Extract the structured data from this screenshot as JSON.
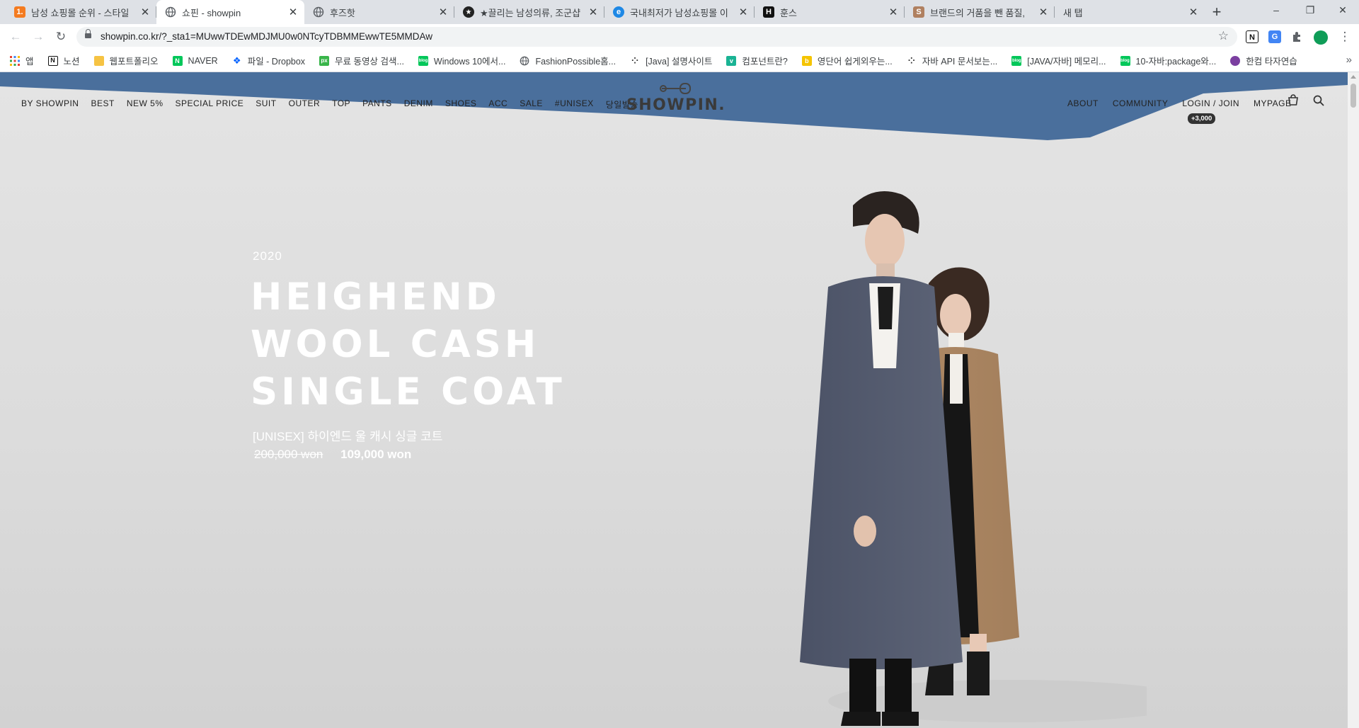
{
  "browser": {
    "tabs": [
      {
        "title": "남성 쇼핑몰 순위 - 스타일",
        "favicon": "1.",
        "favicon_color": "#f47b20",
        "active": false
      },
      {
        "title": "쇼핀 - showpin",
        "favicon": "globe-icon",
        "favicon_color": "#5f6368",
        "active": true
      },
      {
        "title": "후즈핫",
        "favicon": "globe-icon",
        "favicon_color": "#5f6368",
        "active": false
      },
      {
        "title": "★끌리는 남성의류, 조군샵",
        "favicon": "star-badge-icon",
        "favicon_color": "#222222",
        "active": false
      },
      {
        "title": "국내최저가 남성쇼핑몰 이",
        "favicon": "e",
        "favicon_color": "#1e88e5",
        "active": false
      },
      {
        "title": "훈스",
        "favicon": "H",
        "favicon_color": "#111111",
        "active": false
      },
      {
        "title": "브랜드의 거품을 뺀 품질,",
        "favicon": "S",
        "favicon_color": "#b08060",
        "active": false
      },
      {
        "title": "새 탭",
        "favicon": "",
        "favicon_color": "#dee1e6",
        "active": false
      }
    ],
    "new_tab_label": "+",
    "window_controls": {
      "minimize": "–",
      "restore": "❐",
      "close": "✕"
    },
    "url": "showpin.co.kr/?_sta1=MUwwTDEwMDJMU0w0NTcyTDBMMEwwTE5MMDAw",
    "extensions": [
      "N",
      "G",
      "puzzle-icon",
      "profile-avatar"
    ],
    "bookmarks": [
      {
        "label": "앱",
        "icon": "apps-grid-icon",
        "color": "#ea4335"
      },
      {
        "label": "노션",
        "icon": "N",
        "color": "#111111"
      },
      {
        "label": "웹포트폴리오",
        "icon": "folder-icon",
        "color": "#f6c343"
      },
      {
        "label": "NAVER",
        "icon": "N",
        "color": "#03c75a"
      },
      {
        "label": "파일 - Dropbox",
        "icon": "dropbox-icon",
        "color": "#0061ff"
      },
      {
        "label": "무료 동영상 검색...",
        "icon": "px",
        "color": "#39b54a"
      },
      {
        "label": "Windows 10에서...",
        "icon": "blog",
        "color": "#03c75a"
      },
      {
        "label": "FashionPossible홈...",
        "icon": "globe-icon",
        "color": "#5f6368"
      },
      {
        "label": "[Java] 설명사이트",
        "icon": "tistory-icon",
        "color": "#333333"
      },
      {
        "label": "컴포넌트란?",
        "icon": "v",
        "color": "#1ab394"
      },
      {
        "label": "영단어 쉽게외우는...",
        "icon": "b",
        "color": "#f5c400"
      },
      {
        "label": "자바 API 문서보는...",
        "icon": "tistory-icon",
        "color": "#333333"
      },
      {
        "label": "[JAVA/자바] 메모리...",
        "icon": "blog",
        "color": "#03c75a"
      },
      {
        "label": "10-자바:package와...",
        "icon": "blog",
        "color": "#03c75a"
      },
      {
        "label": "한컴 타자연습",
        "icon": "hancom-icon",
        "color": "#7b3fa0"
      }
    ],
    "bookmarks_more": "»"
  },
  "site": {
    "gnb": [
      "BY SHOWPIN",
      "BEST",
      "NEW 5%",
      "SPECIAL PRICE",
      "SUIT",
      "OUTER",
      "TOP",
      "PANTS",
      "DENIM",
      "SHOES",
      "ACC",
      "SALE",
      "#UNISEX",
      "당일발송"
    ],
    "logo": "SHOWPIN.",
    "util": [
      "ABOUT",
      "COMMUNITY",
      "LOGIN / JOIN",
      "MYPAGE"
    ],
    "points_badge": "+3,000",
    "hero": {
      "year": "2020",
      "title_lines": [
        "HEIGHEND",
        "WOOL CASH",
        "SINGLE COAT"
      ],
      "product": "[UNISEX] 하이엔드 울 캐시 싱글 코트",
      "original_price": "200,000 won",
      "sale_price": "109,000 won"
    }
  },
  "colors": {
    "sky": "#4a6f9c",
    "text_dark": "#222222",
    "hero_text": "#ffffff"
  }
}
